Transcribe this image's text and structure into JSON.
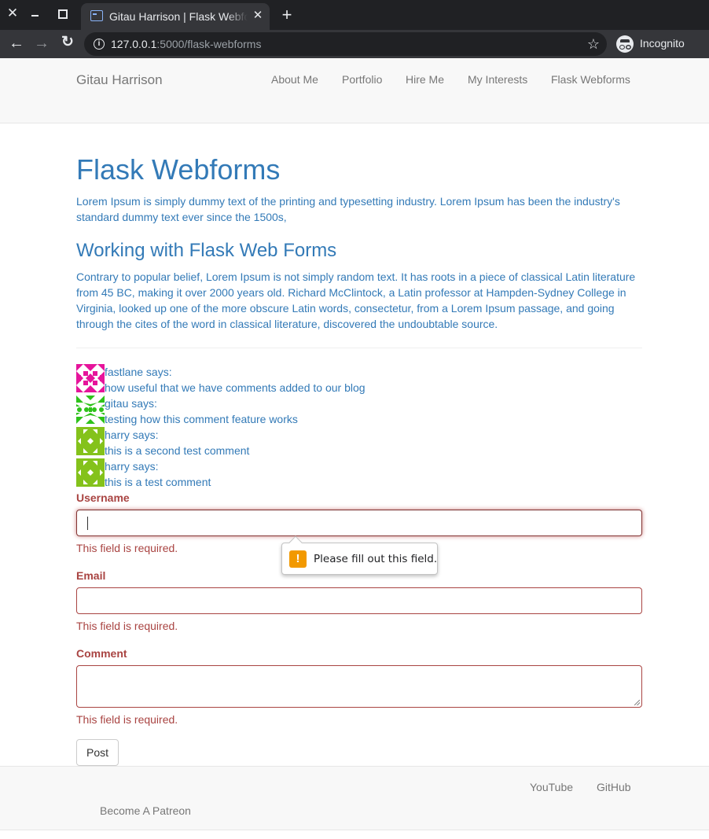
{
  "browser": {
    "tab_title": "Gitau Harrison | Flask Webforms",
    "url_host": "127.0.0.1",
    "url_rest": ":5000/flask-webforms",
    "profile_label": "Incognito"
  },
  "navbar": {
    "brand": "Gitau Harrison",
    "links": [
      "About Me",
      "Portfolio",
      "Hire Me",
      "My Interests",
      "Flask Webforms"
    ]
  },
  "main": {
    "title": "Flask Webforms",
    "lead": "Lorem Ipsum is simply dummy text of the printing and typesetting industry. Lorem Ipsum has been the industry's standard dummy text ever since the 1500s,",
    "subtitle": "Working with Flask Web Forms",
    "body": "Contrary to popular belief, Lorem Ipsum is not simply random text. It has roots in a piece of classical Latin literature from 45 BC, making it over 2000 years old. Richard McClintock, a Latin professor at Hampden-Sydney College in Virginia, looked up one of the more obscure Latin words, consectetur, from a Lorem Ipsum passage, and going through the cites of the word in classical literature, discovered the undoubtable source."
  },
  "comments": [
    {
      "author": "fastlane says:",
      "body": "how useful that we have comments added to our blog",
      "avatar_color": "#e6149b"
    },
    {
      "author": "gitau says:",
      "body": "testing how this comment feature works",
      "avatar_color": "#2ec21b"
    },
    {
      "author": "harry says:",
      "body": "this is a second test comment",
      "avatar_color": "#84c21b"
    },
    {
      "author": "harry says:",
      "body": "this is a test comment",
      "avatar_color": "#84c21b"
    }
  ],
  "form": {
    "username_label": "Username",
    "username_error": "This field is required.",
    "email_label": "Email",
    "email_error": "This field is required.",
    "comment_label": "Comment",
    "comment_error": "This field is required.",
    "validation_tooltip": "Please fill out this field.",
    "submit_label": "Post"
  },
  "footer": {
    "links": [
      "YouTube",
      "GitHub"
    ],
    "patreon": "Become A Patreon"
  },
  "colors": {
    "link": "#337ab7",
    "error": "#a94442",
    "navbar_bg": "#f8f8f8",
    "chrome_dark": "#202124",
    "warning": "#f29900"
  }
}
